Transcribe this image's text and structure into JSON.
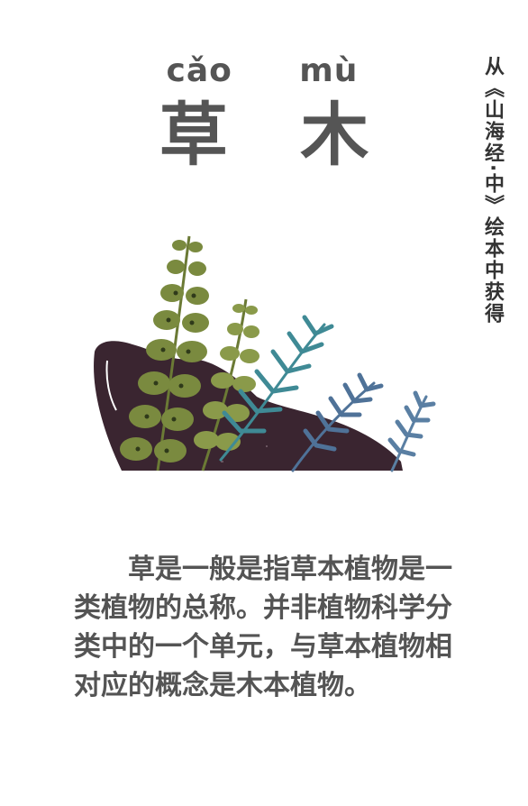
{
  "pinyin": {
    "cao": "cǎo",
    "mu": "mù"
  },
  "title": {
    "cao": "草",
    "mu": "木"
  },
  "side_note": "从《山海经·中》绘本中获得",
  "paragraph": "草是一般是指草本植物是一类植物的总称。并非植物科学分类中的一个单元，与草本植物相对应的概念是木本植物。",
  "colors": {
    "text": "#555555",
    "rock": "#3a2530",
    "olive_leaf": "#7a8a3f",
    "teal_fern": "#3f8a95",
    "blue_fern": "#4f7298"
  },
  "illustration": "plants-and-rock-illustration"
}
